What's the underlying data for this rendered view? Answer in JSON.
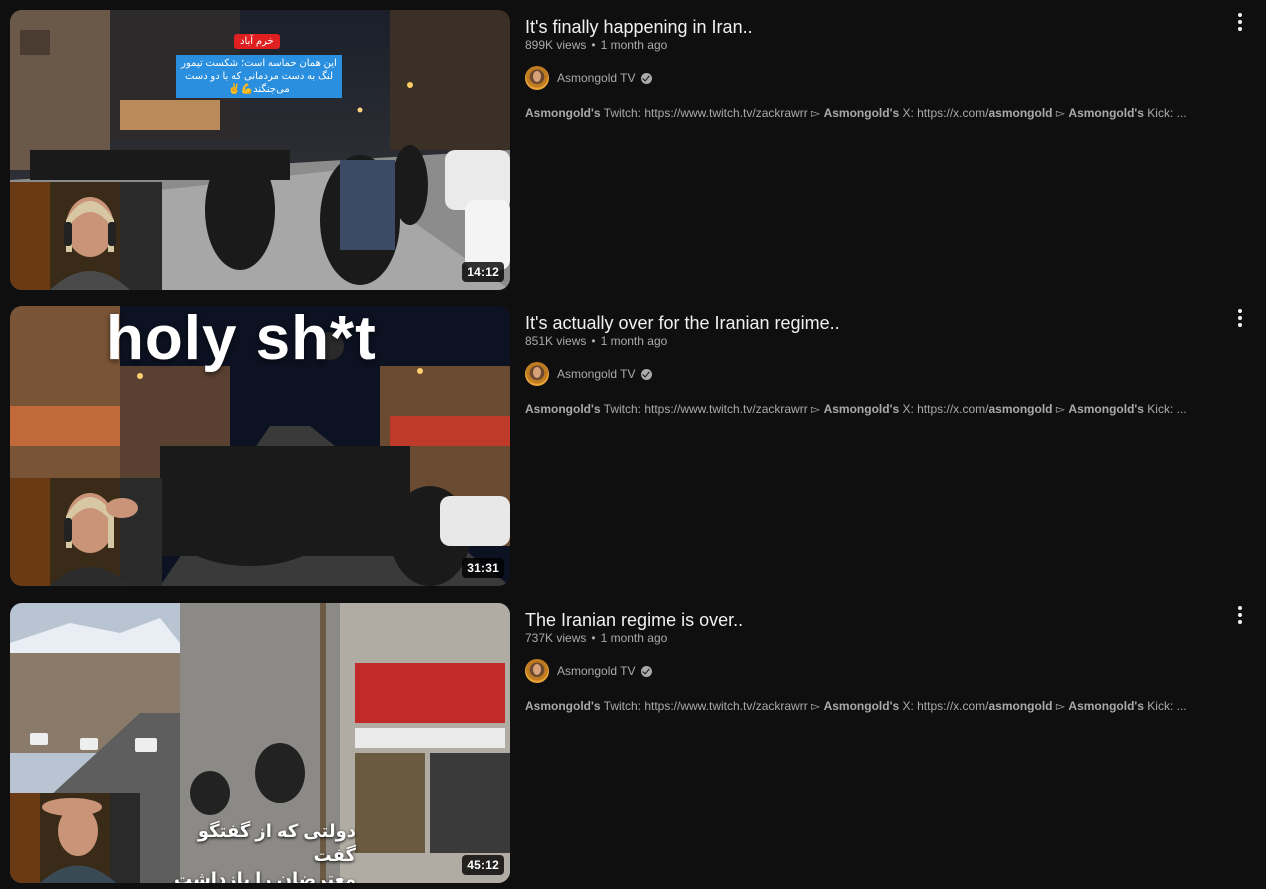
{
  "results": [
    {
      "title": "It's finally happening in Iran..",
      "views": "899K views",
      "age": "1 month ago",
      "channel": "Asmongold TV",
      "duration": "14:12",
      "thumb_label_top": "خرم آباد",
      "thumb_label_body": "این همان حماسه است؛ شکست تیمور لنگ به دست مردمانی که با دو دست می‌جنگند💪✌️",
      "desc": {
        "p1b": "Asmongold's",
        "p1": " Twitch: https://www.twitch.tv/zackrawrr ▻ ",
        "p2b": "Asmongold's",
        "p2": " X: https://x.com/",
        "p3b": "asmongold",
        "p3": " ▻ ",
        "p4b": "Asmongold's",
        "p4": " Kick: ..."
      }
    },
    {
      "title": "It's actually over for the Iranian regime..",
      "views": "851K views",
      "age": "1 month ago",
      "channel": "Asmongold TV",
      "duration": "31:31",
      "thumb_text": "holy sh*t",
      "desc": {
        "p1b": "Asmongold's",
        "p1": " Twitch: https://www.twitch.tv/zackrawrr ▻ ",
        "p2b": "Asmongold's",
        "p2": " X: https://x.com/",
        "p3b": "asmongold",
        "p3": " ▻ ",
        "p4b": "Asmongold's",
        "p4": " Kick: ..."
      }
    },
    {
      "title": "The Iranian regime is over..",
      "views": "737K views",
      "age": "1 month ago",
      "channel": "Asmongold TV",
      "duration": "45:12",
      "thumb_caption_1": "دولتی که از گفتگو گفت",
      "thumb_caption_2": "معترضان را بازداشت کرد",
      "desc": {
        "p1b": "Asmongold's",
        "p1": " Twitch: https://www.twitch.tv/zackrawrr ▻ ",
        "p2b": "Asmongold's",
        "p2": " X: https://x.com/",
        "p3b": "asmongold",
        "p3": " ▻ ",
        "p4b": "Asmongold's",
        "p4": " Kick: ..."
      }
    }
  ],
  "colors": {
    "background": "#0f0f0f",
    "title": "#f1f1f1",
    "secondary": "#aaaaaa",
    "label_red": "#e02020",
    "label_blue": "#2b8fe0"
  }
}
